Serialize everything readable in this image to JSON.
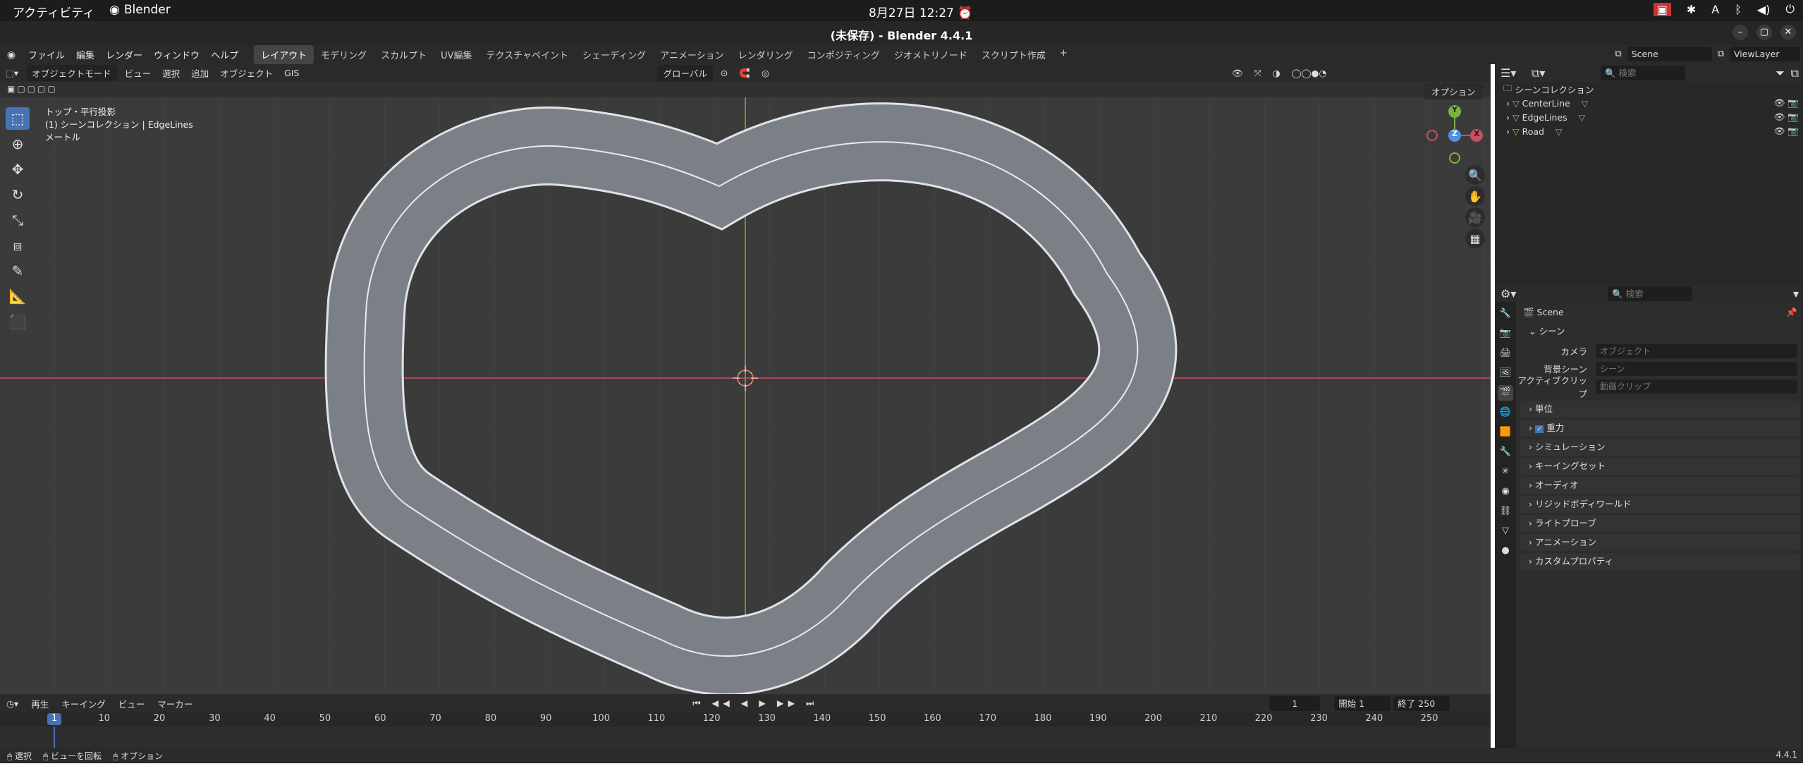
{
  "gnome": {
    "activities": "アクティビティ",
    "app": "Blender",
    "clock": "8月27日  12:27",
    "input": "A"
  },
  "window": {
    "title": "(未保存) - Blender 4.4.1"
  },
  "menu": {
    "items": [
      "ファイル",
      "編集",
      "レンダー",
      "ウィンドウ",
      "ヘルプ"
    ]
  },
  "workspaces": [
    "レイアウト",
    "モデリング",
    "スカルプト",
    "UV編集",
    "テクスチャペイント",
    "シェーディング",
    "アニメーション",
    "レンダリング",
    "コンポジティング",
    "ジオメトリノード",
    "スクリプト作成"
  ],
  "scene_field": "Scene",
  "viewlayer_field": "ViewLayer",
  "viewport_header": {
    "mode": "オブジェクトモード",
    "menus": [
      "ビュー",
      "選択",
      "追加",
      "オブジェクト",
      "GIS"
    ],
    "orientation": "グローバル"
  },
  "viewport": {
    "view_name": "トップ・平行投影",
    "collection_info": "(1) シーンコレクション | EdgeLines",
    "units": "メートル",
    "options": "オプション",
    "gizmo": {
      "y": "Y",
      "x": "X",
      "z": "Z"
    }
  },
  "timeline": {
    "menus": [
      "再生",
      "キーイング",
      "ビュー",
      "マーカー"
    ],
    "current_frame": "1",
    "start_label": "開始",
    "start": "1",
    "end_label": "終了",
    "end": "250",
    "ticks": [
      "1",
      "10",
      "20",
      "30",
      "40",
      "50",
      "60",
      "70",
      "80",
      "90",
      "100",
      "110",
      "120",
      "130",
      "140",
      "150",
      "160",
      "170",
      "180",
      "190",
      "200",
      "210",
      "220",
      "230",
      "240",
      "250"
    ]
  },
  "status": {
    "select": "選択",
    "rotate": "ビューを回転",
    "options": "オプション",
    "version": "4.4.1"
  },
  "outliner": {
    "search_placeholder": "検索",
    "root": "シーンコレクション",
    "items": [
      {
        "name": "CenterLine"
      },
      {
        "name": "EdgeLines"
      },
      {
        "name": "Road"
      }
    ]
  },
  "properties": {
    "search_placeholder": "検索",
    "context": "Scene",
    "section": "シーン",
    "rows": [
      {
        "label": "カメラ",
        "placeholder": "オブジェクト"
      },
      {
        "label": "背景シーン",
        "placeholder": "シーン"
      },
      {
        "label": "アクティブクリップ",
        "placeholder": "動画クリップ"
      }
    ],
    "panels": [
      "単位",
      "重力",
      "シミュレーション",
      "キーイングセット",
      "オーディオ",
      "リジッドボディワールド",
      "ライトプローブ",
      "アニメーション",
      "カスタムプロパティ"
    ]
  },
  "colors": {
    "accent": "#4772b3",
    "road": "#7b7f86",
    "x_axis": "#c9505f",
    "y_axis": "#7ab33c"
  }
}
